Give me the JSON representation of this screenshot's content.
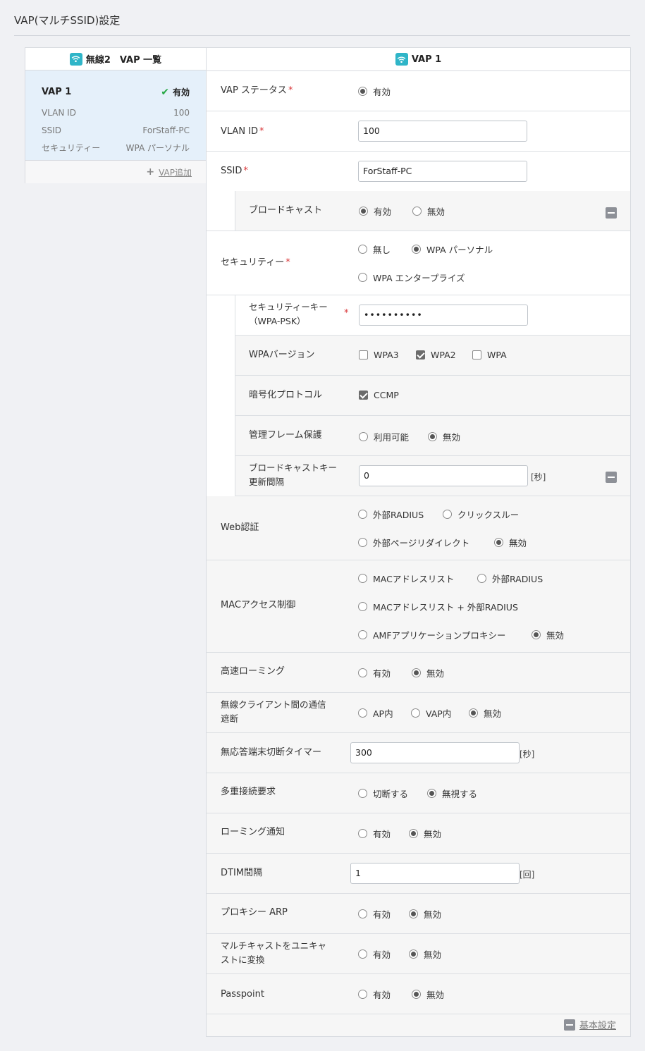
{
  "page": {
    "title": "VAP(マルチSSID)設定"
  },
  "left": {
    "header": "無線2　VAP 一覧",
    "vap": {
      "name": "VAP 1",
      "status": "有効",
      "rows": [
        {
          "label": "VLAN ID",
          "value": "100"
        },
        {
          "label": "SSID",
          "value": "ForStaff-PC"
        },
        {
          "label": "セキュリティー",
          "value": "WPA パーソナル"
        }
      ]
    },
    "add_label": "VAP追加"
  },
  "right": {
    "header": "VAP 1",
    "vap_status": {
      "label": "VAP ステータス",
      "options": [
        {
          "text": "有効",
          "checked": true
        }
      ]
    },
    "vlan_id": {
      "label": "VLAN ID",
      "value": "100"
    },
    "ssid": {
      "label": "SSID",
      "value": "ForStaff-PC"
    },
    "broadcast": {
      "label": "ブロードキャスト",
      "options": [
        {
          "text": "有効",
          "checked": true
        },
        {
          "text": "無効",
          "checked": false
        }
      ]
    },
    "security": {
      "label": "セキュリティー",
      "options": [
        {
          "text": "無し",
          "checked": false
        },
        {
          "text": "WPA パーソナル",
          "checked": true
        },
        {
          "text": "WPA エンタープライズ",
          "checked": false
        }
      ]
    },
    "security_key": {
      "label1": "セキュリティーキー",
      "label2": "（WPA-PSK）",
      "value": "••••••••••"
    },
    "wpa_version": {
      "label": "WPAバージョン",
      "options": [
        {
          "text": "WPA3",
          "checked": false
        },
        {
          "text": "WPA2",
          "checked": true
        },
        {
          "text": "WPA",
          "checked": false
        }
      ]
    },
    "encryption": {
      "label": "暗号化プロトコル",
      "options": [
        {
          "text": "CCMP",
          "checked": true
        }
      ]
    },
    "mgmt_frame": {
      "label": "管理フレーム保護",
      "options": [
        {
          "text": "利用可能",
          "checked": false
        },
        {
          "text": "無効",
          "checked": true
        }
      ]
    },
    "bcast_key": {
      "label1": "ブロードキャストキー",
      "label2": "更新間隔",
      "value": "0",
      "unit": "[秒]"
    },
    "web_auth": {
      "label": "Web認証",
      "options": [
        {
          "text": "外部RADIUS",
          "checked": false
        },
        {
          "text": "クリックスルー",
          "checked": false
        },
        {
          "text": "外部ページリダイレクト",
          "checked": false
        },
        {
          "text": "無効",
          "checked": true
        }
      ]
    },
    "mac_access": {
      "label": "MACアクセス制御",
      "options": [
        {
          "text": "MACアドレスリスト",
          "checked": false
        },
        {
          "text": "外部RADIUS",
          "checked": false
        },
        {
          "text": "MACアドレスリスト + 外部RADIUS",
          "checked": false
        },
        {
          "text": "AMFアプリケーションプロキシー",
          "checked": false
        },
        {
          "text": "無効",
          "checked": true
        }
      ]
    },
    "fast_roaming": {
      "label": "高速ローミング",
      "options": [
        {
          "text": "有効",
          "checked": false
        },
        {
          "text": "無効",
          "checked": true
        }
      ]
    },
    "client_isolation": {
      "label1": "無線クライアント間の通信",
      "label2": "遮断",
      "options": [
        {
          "text": "AP内",
          "checked": false
        },
        {
          "text": "VAP内",
          "checked": false
        },
        {
          "text": "無効",
          "checked": true
        }
      ]
    },
    "idle_timer": {
      "label": "無応答端末切断タイマー",
      "value": "300",
      "unit": "[秒]"
    },
    "multi_conn": {
      "label": "多重接続要求",
      "options": [
        {
          "text": "切断する",
          "checked": false
        },
        {
          "text": "無視する",
          "checked": true
        }
      ]
    },
    "roaming_notify": {
      "label": "ローミング通知",
      "options": [
        {
          "text": "有効",
          "checked": false
        },
        {
          "text": "無効",
          "checked": true
        }
      ]
    },
    "dtim": {
      "label": "DTIM間隔",
      "value": "1",
      "unit": "[回]"
    },
    "proxy_arp": {
      "label": "プロキシー ARP",
      "options": [
        {
          "text": "有効",
          "checked": false
        },
        {
          "text": "無効",
          "checked": true
        }
      ]
    },
    "mcast_ucast": {
      "label1": "マルチキャストをユニキャ",
      "label2": "ストに変換",
      "options": [
        {
          "text": "有効",
          "checked": false
        },
        {
          "text": "無効",
          "checked": true
        }
      ]
    },
    "passpoint": {
      "label": "Passpoint",
      "options": [
        {
          "text": "有効",
          "checked": false
        },
        {
          "text": "無効",
          "checked": true
        }
      ]
    },
    "basic_settings": "基本設定"
  }
}
